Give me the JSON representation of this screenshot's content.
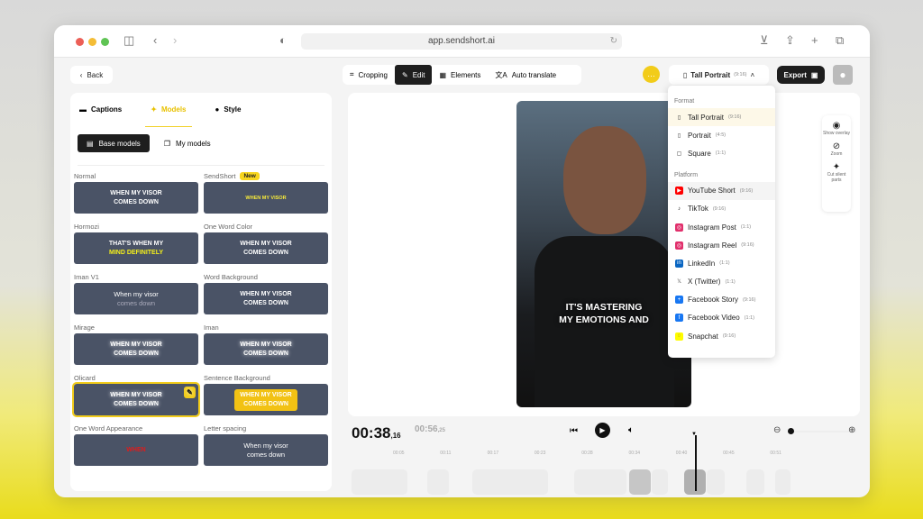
{
  "browser": {
    "url": "app.sendshort.ai"
  },
  "toolbar": {
    "back": "Back",
    "tools": [
      {
        "label": "Cropping",
        "icon": "crop-icon"
      },
      {
        "label": "Edit",
        "icon": "pencil-icon",
        "active": true
      },
      {
        "label": "Elements",
        "icon": "grid-icon"
      },
      {
        "label": "Auto translate",
        "icon": "translate-icon"
      }
    ],
    "format_button": "Tall Portrait",
    "format_ratio": "(9:16)",
    "export": "Export"
  },
  "left_panel": {
    "tabs": [
      "Captions",
      "Models",
      "Style"
    ],
    "active_tab": "Models",
    "segments": [
      "Base models",
      "My models"
    ],
    "models": [
      {
        "name": "Normal",
        "lines": [
          "WHEN MY VISOR",
          "COMES DOWN"
        ]
      },
      {
        "name": "SendShort",
        "badge": "New",
        "lines": [
          "WHEN MY VISOR",
          ""
        ]
      },
      {
        "name": "Hormozi",
        "lines": [
          "THAT'S WHEN MY",
          "MIND DEFINITELY"
        ]
      },
      {
        "name": "One Word Color",
        "lines": [
          "WHEN MY VISOR",
          "COMES DOWN"
        ]
      },
      {
        "name": "Iman V1",
        "lines": [
          "When my visor",
          "comes down"
        ]
      },
      {
        "name": "Word Background",
        "lines": [
          "WHEN MY VISOR",
          "COMES DOWN"
        ]
      },
      {
        "name": "Mirage",
        "lines": [
          "WHEN MY VISOR",
          "COMES DOWN"
        ]
      },
      {
        "name": "Iman",
        "lines": [
          "WHEN MY VISOR",
          "COMES DOWN"
        ]
      },
      {
        "name": "Olicard",
        "lines": [
          "WHEN MY VISOR",
          "COMES DOWN"
        ],
        "selected": true
      },
      {
        "name": "Sentence Background",
        "lines": [
          "WHEN MY VISOR",
          "COMES DOWN"
        ]
      },
      {
        "name": "One Word Appearance",
        "lines": [
          "WHEN",
          ""
        ]
      },
      {
        "name": "Letter spacing",
        "lines": [
          "When my visor",
          "comes down"
        ]
      }
    ]
  },
  "video": {
    "caption": [
      "IT'S MASTERING",
      "MY EMOTIONS AND"
    ]
  },
  "side_tools": [
    "Show overlay",
    "Zoom",
    "Cut silent parts"
  ],
  "format_menu": {
    "format_heading": "Format",
    "platform_heading": "Platform",
    "formats": [
      {
        "label": "Tall Portrait",
        "ratio": "(9:16)"
      },
      {
        "label": "Portrait",
        "ratio": "(4:5)"
      },
      {
        "label": "Square",
        "ratio": "(1:1)"
      }
    ],
    "platforms": [
      {
        "label": "YouTube Short",
        "ratio": "(9:16)",
        "color": "#ff0000"
      },
      {
        "label": "TikTok",
        "ratio": "(9:16)",
        "color": "#000000"
      },
      {
        "label": "Instagram Post",
        "ratio": "(1:1)",
        "color": "#e1306c"
      },
      {
        "label": "Instagram Reel",
        "ratio": "(9:16)",
        "color": "#e1306c"
      },
      {
        "label": "LinkedIn",
        "ratio": "(1:1)",
        "color": "#0a66c2"
      },
      {
        "label": "X (Twitter)",
        "ratio": "(1:1)",
        "color": "#555555"
      },
      {
        "label": "Facebook Story",
        "ratio": "(9:16)",
        "color": "#1877f2"
      },
      {
        "label": "Facebook Video",
        "ratio": "(1:1)",
        "color": "#1877f2"
      },
      {
        "label": "Snapchat",
        "ratio": "(9:16)",
        "color": "#fffc00"
      }
    ]
  },
  "timeline": {
    "current": "00:38",
    "current_frac": ",16",
    "total": "00:56",
    "total_frac": ",25",
    "ticks": [
      "00:05",
      "00:11",
      "00:17",
      "00:23",
      "00:28",
      "00:34",
      "00:40",
      "00:45",
      "00:51"
    ]
  },
  "colors": {
    "accent": "#f2cc1a",
    "dark": "#1e1e1e"
  }
}
